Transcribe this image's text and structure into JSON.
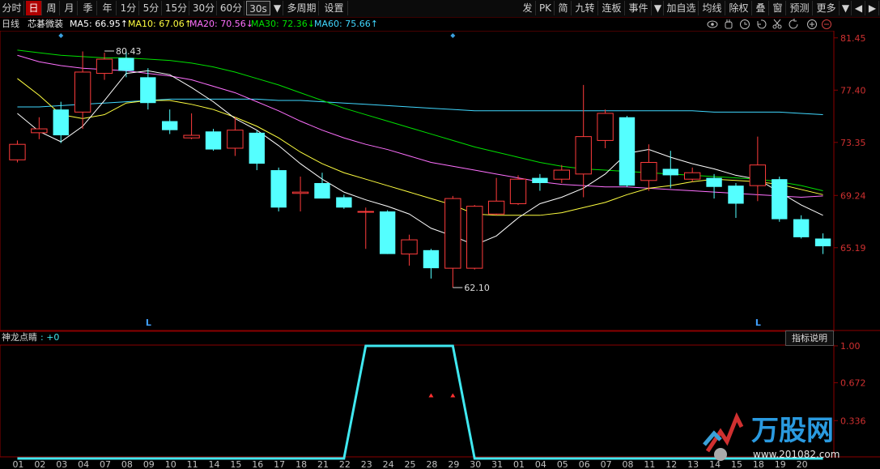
{
  "toolbar": {
    "left": [
      {
        "label": "分时",
        "w": 30
      },
      {
        "label": "日",
        "w": 20,
        "active": true
      },
      {
        "label": "周",
        "w": 20
      },
      {
        "label": "月",
        "w": 20
      },
      {
        "label": "季",
        "w": 22
      },
      {
        "label": "年",
        "w": 22
      },
      {
        "label": "1分",
        "w": 26
      },
      {
        "label": "5分",
        "w": 26
      },
      {
        "label": "15分",
        "w": 32
      },
      {
        "label": "30分",
        "w": 32
      },
      {
        "label": "60分",
        "w": 32
      },
      {
        "label": "30s",
        "w": 30,
        "box": true
      },
      {
        "label": "▼",
        "w": 14
      },
      {
        "label": "多周期",
        "w": 42
      },
      {
        "label": "设置",
        "w": 34
      }
    ],
    "right": [
      {
        "label": "发",
        "w": 20
      },
      {
        "label": "PK",
        "w": 22
      },
      {
        "label": "简",
        "w": 20
      },
      {
        "label": "九转",
        "w": 32
      },
      {
        "label": "连板",
        "w": 32
      },
      {
        "label": "事件",
        "w": 32
      },
      {
        "label": "▼",
        "w": 14
      },
      {
        "label": "加自选",
        "w": 42
      },
      {
        "label": "均线",
        "w": 32
      },
      {
        "label": "除权",
        "w": 32
      },
      {
        "label": "叠",
        "w": 20
      },
      {
        "label": "窗",
        "w": 20
      },
      {
        "label": "预测",
        "w": 32
      },
      {
        "label": "更多",
        "w": 32
      },
      {
        "label": "▼",
        "w": 14
      },
      {
        "label": "◀",
        "w": 16
      },
      {
        "label": "▶",
        "w": 16
      }
    ]
  },
  "legend": {
    "period": "日线",
    "name": "芯碁微装",
    "ma5": "MA5: 66.95↑",
    "ma10": "MA10: 67.06↑",
    "ma20": "MA20: 70.56↓",
    "ma30": "MA30: 72.36↓",
    "ma60": "MA60: 75.66↑",
    "ma5_color": "#ffffff",
    "ma10_color": "#ffff40",
    "ma20_color": "#ff70ff",
    "ma30_color": "#00e000",
    "ma60_color": "#40d8ff"
  },
  "chart_data": [
    {
      "type": "candlestick",
      "ylim": [
        58.9,
        82.0
      ],
      "price_ticks": [
        "81.45",
        "77.40",
        "73.35",
        "69.24",
        "65.19"
      ],
      "price_tick_values": [
        81.45,
        77.4,
        73.35,
        69.24,
        65.19
      ],
      "x_labels": [
        "01",
        "02",
        "03",
        "04",
        "07",
        "08",
        "09",
        "10",
        "11",
        "14",
        "15",
        "16",
        "17",
        "18",
        "21",
        "22",
        "23",
        "24",
        "25",
        "28",
        "29",
        "30",
        "31",
        "01",
        "04",
        "05",
        "06",
        "07",
        "08",
        "11",
        "12",
        "13",
        "14",
        "15",
        "18",
        "19",
        "20"
      ],
      "annotations": [
        {
          "text": "80.43",
          "x_index": 4,
          "value": 80.43
        },
        {
          "text": "62.10",
          "x_index": 20,
          "value": 62.1
        }
      ],
      "markers": [
        {
          "text": "L",
          "x_index": 6
        },
        {
          "text": "L",
          "x_index": 34
        }
      ],
      "candles": [
        {
          "o": 72.0,
          "c": 73.2,
          "h": 73.5,
          "l": 71.8
        },
        {
          "o": 74.1,
          "c": 74.4,
          "h": 75.3,
          "l": 73.6
        },
        {
          "o": 75.9,
          "c": 73.9,
          "h": 76.5,
          "l": 73.3
        },
        {
          "o": 75.7,
          "c": 78.8,
          "h": 80.4,
          "l": 74.4
        },
        {
          "o": 78.7,
          "c": 79.8,
          "h": 80.3,
          "l": 78.2
        },
        {
          "o": 79.9,
          "c": 78.9,
          "h": 80.4,
          "l": 78.4
        },
        {
          "o": 78.4,
          "c": 76.4,
          "h": 79.1,
          "l": 75.9
        },
        {
          "o": 75.0,
          "c": 74.3,
          "h": 75.9,
          "l": 74.0
        },
        {
          "o": 73.7,
          "c": 73.9,
          "h": 75.6,
          "l": 73.6
        },
        {
          "o": 74.2,
          "c": 72.8,
          "h": 74.4,
          "l": 72.7
        },
        {
          "o": 72.9,
          "c": 74.3,
          "h": 75.3,
          "l": 72.3
        },
        {
          "o": 74.1,
          "c": 71.7,
          "h": 74.3,
          "l": 71.2
        },
        {
          "o": 71.2,
          "c": 68.3,
          "h": 71.4,
          "l": 68.0
        },
        {
          "o": 69.4,
          "c": 69.5,
          "h": 70.7,
          "l": 68.0
        },
        {
          "o": 70.2,
          "c": 69.0,
          "h": 71.0,
          "l": 69.0
        },
        {
          "o": 69.1,
          "c": 68.3,
          "h": 69.3,
          "l": 68.2
        },
        {
          "o": 68.0,
          "c": 68.0,
          "h": 68.3,
          "l": 65.1
        },
        {
          "o": 68.0,
          "c": 64.7,
          "h": 68.1,
          "l": 64.7
        },
        {
          "o": 64.7,
          "c": 65.8,
          "h": 66.2,
          "l": 63.8
        },
        {
          "o": 65.0,
          "c": 63.6,
          "h": 65.1,
          "l": 62.8
        },
        {
          "o": 63.6,
          "c": 69.0,
          "h": 69.2,
          "l": 62.1
        },
        {
          "o": 63.6,
          "c": 68.4,
          "h": 68.5,
          "l": 63.5
        },
        {
          "o": 67.8,
          "c": 68.8,
          "h": 70.6,
          "l": 67.7
        },
        {
          "o": 68.6,
          "c": 70.5,
          "h": 70.8,
          "l": 68.5
        },
        {
          "o": 70.6,
          "c": 70.2,
          "h": 70.9,
          "l": 69.6
        },
        {
          "o": 70.5,
          "c": 71.2,
          "h": 71.6,
          "l": 70.2
        },
        {
          "o": 70.9,
          "c": 73.8,
          "h": 77.8,
          "l": 69.1
        },
        {
          "o": 73.5,
          "c": 75.6,
          "h": 75.9,
          "l": 72.9
        },
        {
          "o": 75.3,
          "c": 70.0,
          "h": 75.4,
          "l": 69.9
        },
        {
          "o": 70.4,
          "c": 71.8,
          "h": 73.2,
          "l": 69.6
        },
        {
          "o": 71.3,
          "c": 70.8,
          "h": 72.7,
          "l": 69.8
        },
        {
          "o": 70.5,
          "c": 71.0,
          "h": 71.4,
          "l": 70.3
        },
        {
          "o": 70.6,
          "c": 69.9,
          "h": 70.9,
          "l": 69.0
        },
        {
          "o": 70.0,
          "c": 68.6,
          "h": 70.2,
          "l": 67.5
        },
        {
          "o": 70.0,
          "c": 71.6,
          "h": 73.8,
          "l": 68.8
        },
        {
          "o": 70.5,
          "c": 67.4,
          "h": 70.7,
          "l": 67.2
        },
        {
          "o": 67.4,
          "c": 66.0,
          "h": 67.7,
          "l": 65.9
        },
        {
          "o": 65.9,
          "c": 65.3,
          "h": 66.3,
          "l": 64.7
        }
      ],
      "ma": {
        "ma5": [
          75.6,
          74.2,
          73.4,
          74.6,
          76.6,
          78.7,
          78.9,
          78.6,
          77.6,
          76.5,
          75.2,
          74.3,
          73.1,
          71.7,
          70.5,
          69.5,
          68.9,
          68.4,
          67.8,
          66.7,
          66.1,
          65.4,
          66.1,
          67.5,
          68.6,
          69.1,
          69.8,
          70.9,
          72.5,
          72.8,
          72.2,
          71.7,
          71.3,
          70.8,
          70.5,
          69.5,
          68.5,
          67.7
        ],
        "ma10": [
          78.3,
          77.0,
          75.5,
          75.2,
          75.5,
          76.4,
          76.6,
          76.6,
          76.3,
          75.9,
          75.3,
          74.6,
          73.7,
          72.6,
          71.7,
          71.0,
          70.5,
          70.0,
          69.5,
          69.0,
          68.5,
          67.8,
          67.7,
          67.7,
          67.7,
          67.9,
          68.3,
          68.7,
          69.3,
          69.8,
          70.0,
          70.3,
          70.5,
          70.4,
          70.3,
          70.1,
          69.7,
          69.3
        ],
        "ma20": [
          80.1,
          79.6,
          79.3,
          79.1,
          79.0,
          78.9,
          78.7,
          78.5,
          78.2,
          77.7,
          77.2,
          76.5,
          75.8,
          75.0,
          74.3,
          73.7,
          73.2,
          72.8,
          72.3,
          71.8,
          71.5,
          71.2,
          70.9,
          70.6,
          70.3,
          70.1,
          70.0,
          69.9,
          69.9,
          69.8,
          69.7,
          69.6,
          69.5,
          69.4,
          69.3,
          69.2,
          69.1,
          69.2
        ],
        "ma30": [
          80.5,
          80.3,
          80.1,
          80.0,
          79.9,
          79.9,
          79.8,
          79.7,
          79.5,
          79.2,
          78.8,
          78.3,
          77.8,
          77.2,
          76.6,
          76.0,
          75.5,
          75.0,
          74.5,
          74.0,
          73.5,
          73.0,
          72.6,
          72.2,
          71.8,
          71.5,
          71.3,
          71.2,
          71.1,
          71.0,
          70.9,
          70.8,
          70.7,
          70.6,
          70.5,
          70.3,
          70.0,
          69.6
        ],
        "ma60": [
          76.1,
          76.1,
          76.2,
          76.3,
          76.4,
          76.5,
          76.6,
          76.7,
          76.7,
          76.7,
          76.7,
          76.7,
          76.6,
          76.6,
          76.5,
          76.4,
          76.3,
          76.2,
          76.1,
          76.0,
          75.9,
          75.8,
          75.8,
          75.8,
          75.8,
          75.8,
          75.8,
          75.8,
          75.8,
          75.8,
          75.8,
          75.8,
          75.7,
          75.7,
          75.7,
          75.7,
          75.6,
          75.5
        ]
      }
    },
    {
      "type": "line",
      "name": "神龙点睛",
      "ylim": [
        0,
        1.05
      ],
      "y_ticks": [
        "1.00",
        "0.672",
        "0.336"
      ],
      "y_tick_values": [
        1.0,
        0.672,
        0.336
      ],
      "values": [
        0,
        0,
        0,
        0,
        0,
        0,
        0,
        0,
        0,
        0,
        0,
        0,
        0,
        0,
        0,
        0,
        1,
        1,
        1,
        1,
        1,
        0,
        0,
        0,
        0,
        0,
        0,
        0,
        0,
        0,
        0,
        0,
        0,
        0,
        0,
        0,
        0,
        0
      ],
      "series_color": "#40e8f0",
      "triangle_markers": [
        19,
        20
      ]
    }
  ],
  "subchart": {
    "label": "神龙点睛",
    "value": ": +0",
    "button": "指标说明"
  },
  "watermark": {
    "brand": "万股网",
    "url": "www.201082.com"
  },
  "icons": [
    "eye-icon",
    "hand-icon",
    "history-icon",
    "back-icon",
    "scissors-icon",
    "refresh-icon",
    "add-icon",
    "minus-icon"
  ]
}
